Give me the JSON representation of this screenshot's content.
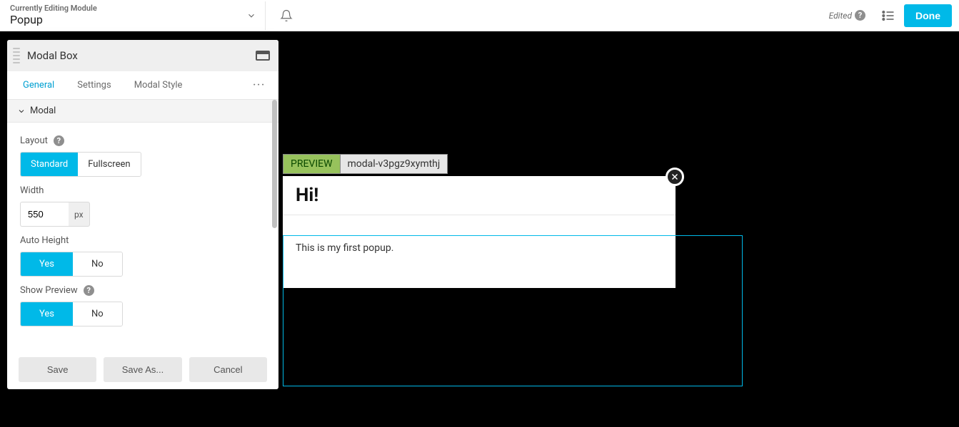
{
  "header": {
    "module_label": "Currently Editing Module",
    "module_name": "Popup",
    "edited_text": "Edited",
    "done_label": "Done"
  },
  "panel": {
    "title": "Modal Box",
    "tabs": {
      "general": "General",
      "settings": "Settings",
      "modal_style": "Modal Style"
    },
    "section_modal_label": "Modal",
    "fields": {
      "layout_label": "Layout",
      "layout_standard": "Standard",
      "layout_fullscreen": "Fullscreen",
      "width_label": "Width",
      "width_value": "550",
      "width_unit": "px",
      "autoheight_label": "Auto Height",
      "yes": "Yes",
      "no": "No",
      "showpreview_label": "Show Preview"
    },
    "footer": {
      "save": "Save",
      "save_as": "Save As...",
      "cancel": "Cancel"
    }
  },
  "preview": {
    "badge": "PREVIEW",
    "id": "modal-v3pgz9xymthj",
    "title": "Hi!",
    "body": "This is my first popup."
  }
}
